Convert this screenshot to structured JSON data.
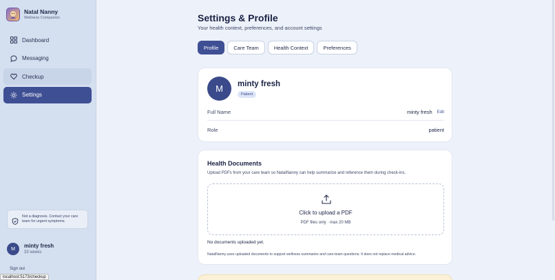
{
  "brand": {
    "title": "Natal Nanny",
    "subtitle": "Wellness Companion"
  },
  "nav": {
    "items": [
      {
        "label": "Dashboard",
        "icon": "grid-icon"
      },
      {
        "label": "Messaging",
        "icon": "chat-bubble-icon"
      },
      {
        "label": "Checkup",
        "icon": "heart-icon"
      },
      {
        "label": "Settings",
        "icon": "sun-gear-icon"
      }
    ],
    "active": "Settings",
    "hovered": "Checkup"
  },
  "disclaimer": {
    "text": "Not a diagnosis. Contact your care team for urgent symptoms."
  },
  "user": {
    "initial": "M",
    "name": "minty fresh",
    "detail": "33 weeks",
    "signout": "Sign out"
  },
  "status_url": "localhost:5173/checkup",
  "page": {
    "title": "Settings & Profile",
    "subtitle": "Your health context, preferences, and account settings"
  },
  "tabs": [
    {
      "label": "Profile",
      "active": true
    },
    {
      "label": "Care Team",
      "active": false
    },
    {
      "label": "Health Context",
      "active": false
    },
    {
      "label": "Preferences",
      "active": false
    }
  ],
  "profile": {
    "initial": "M",
    "name": "minty fresh",
    "badge": "Patient",
    "rows": [
      {
        "label": "Full Name",
        "value": "minty fresh",
        "action": "Edit"
      },
      {
        "label": "Role",
        "value": "patient"
      }
    ]
  },
  "documents": {
    "title": "Health Documents",
    "description": "Upload PDFs from your care team so NatalNanny can help summarize and reference them during check-ins.",
    "upload_label": "Click to upload a PDF",
    "upload_hint": "PDF files only · max 20 MB",
    "empty_text": "No documents uploaded yet.",
    "footnote": "NatalNanny uses uploaded documents to support wellness summaries and care-team questions. It does not replace medical advice."
  },
  "colors": {
    "accent": "#3f4f94",
    "sidebar": "#d4dfef",
    "background": "#edf1f9"
  }
}
